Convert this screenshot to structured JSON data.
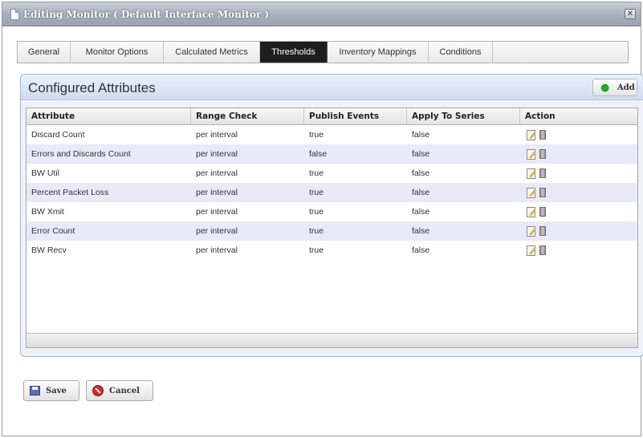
{
  "window": {
    "title": "Editing Monitor ( Default Interface Monitor )",
    "close_label": "✕"
  },
  "tabs": [
    {
      "label": "General",
      "active": false
    },
    {
      "label": "Monitor Options",
      "active": false
    },
    {
      "label": "Calculated Metrics",
      "active": false
    },
    {
      "label": "Thresholds",
      "active": true
    },
    {
      "label": "Inventory Mappings",
      "active": false
    },
    {
      "label": "Conditions",
      "active": false
    }
  ],
  "panel": {
    "title": "Configured Attributes",
    "add_label": "Add",
    "add_icon": "plus-icon"
  },
  "table": {
    "columns": [
      "Attribute",
      "Range Check",
      "Publish Events",
      "Apply To Series",
      "Action"
    ],
    "rows": [
      {
        "attribute": "Discard Count",
        "range_check": "per interval",
        "publish_events": "true",
        "apply_to_series": "false"
      },
      {
        "attribute": "Errors and Discards Count",
        "range_check": "per interval",
        "publish_events": "false",
        "apply_to_series": "false"
      },
      {
        "attribute": "BW Util",
        "range_check": "per interval",
        "publish_events": "true",
        "apply_to_series": "false"
      },
      {
        "attribute": "Percent Packet Loss",
        "range_check": "per interval",
        "publish_events": "true",
        "apply_to_series": "false"
      },
      {
        "attribute": "BW Xmit",
        "range_check": "per interval",
        "publish_events": "true",
        "apply_to_series": "false"
      },
      {
        "attribute": "Error Count",
        "range_check": "per interval",
        "publish_events": "true",
        "apply_to_series": "false"
      },
      {
        "attribute": "BW Recv",
        "range_check": "per interval",
        "publish_events": "true",
        "apply_to_series": "false"
      }
    ],
    "action_icons": [
      "edit-icon",
      "delete-icon"
    ]
  },
  "footer": {
    "save_label": "Save",
    "cancel_label": "Cancel"
  },
  "colors": {
    "active_tab": "#1e1e1e",
    "alt_row": "#e9e9f7",
    "panel_header": "#cfdcef",
    "add_plus": "#2aa82a",
    "cancel_icon": "#cf2b2b"
  }
}
